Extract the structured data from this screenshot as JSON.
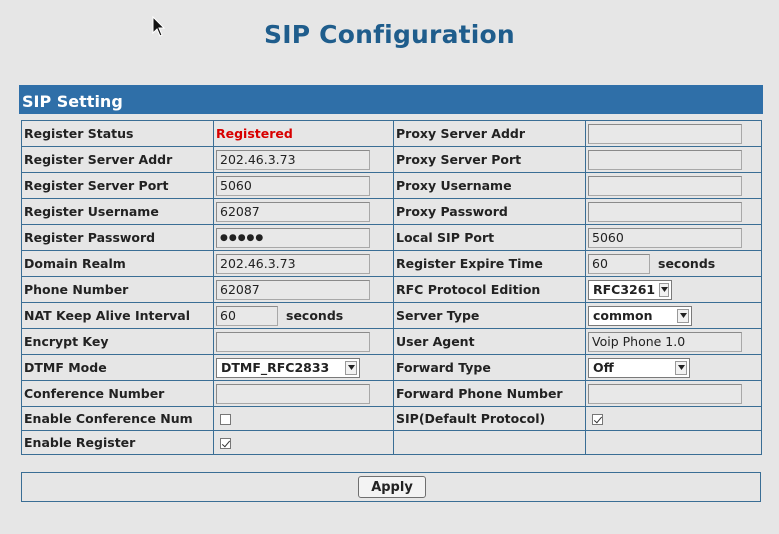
{
  "page": {
    "title": "SIP Configuration"
  },
  "section": {
    "title": "SIP Setting"
  },
  "left": {
    "register_status": {
      "label": "Register Status",
      "value": "Registered"
    },
    "register_server_addr": {
      "label": "Register Server Addr",
      "value": "202.46.3.73"
    },
    "register_server_port": {
      "label": "Register Server Port",
      "value": "5060"
    },
    "register_username": {
      "label": "Register Username",
      "value": "62087"
    },
    "register_password": {
      "label": "Register Password",
      "value": "●●●●●"
    },
    "domain_realm": {
      "label": "Domain Realm",
      "value": "202.46.3.73"
    },
    "phone_number": {
      "label": "Phone Number",
      "value": "62087"
    },
    "nat_keep_alive": {
      "label": "NAT Keep Alive Interval",
      "value": "60",
      "unit": "seconds"
    },
    "encrypt_key": {
      "label": "Encrypt Key",
      "value": ""
    },
    "dtmf_mode": {
      "label": "DTMF Mode",
      "value": "DTMF_RFC2833"
    },
    "conference_number": {
      "label": "Conference Number",
      "value": ""
    },
    "enable_conference_num": {
      "label": "Enable Conference Num",
      "checked": false
    },
    "enable_register": {
      "label": "Enable Register",
      "checked": true
    }
  },
  "right": {
    "proxy_server_addr": {
      "label": "Proxy Server Addr",
      "value": ""
    },
    "proxy_server_port": {
      "label": "Proxy Server Port",
      "value": ""
    },
    "proxy_username": {
      "label": "Proxy Username",
      "value": ""
    },
    "proxy_password": {
      "label": "Proxy Password",
      "value": ""
    },
    "local_sip_port": {
      "label": "Local SIP Port",
      "value": "5060"
    },
    "register_expire_time": {
      "label": "Register Expire Time",
      "value": "60",
      "unit": "seconds"
    },
    "rfc_protocol_edition": {
      "label": "RFC Protocol Edition",
      "value": "RFC3261"
    },
    "server_type": {
      "label": "Server Type",
      "value": "common"
    },
    "user_agent": {
      "label": "User Agent",
      "value": "Voip Phone 1.0"
    },
    "forward_type": {
      "label": "Forward Type",
      "value": "Off"
    },
    "forward_phone_number": {
      "label": "Forward Phone Number",
      "value": ""
    },
    "sip_default_protocol": {
      "label": "SIP(Default Protocol)",
      "checked": true
    }
  },
  "footer": {
    "apply_label": "Apply"
  },
  "colors": {
    "header_bg": "#2f6fa8",
    "title": "#1f5d8c",
    "status": "#d80000",
    "border": "#3a6e95"
  }
}
